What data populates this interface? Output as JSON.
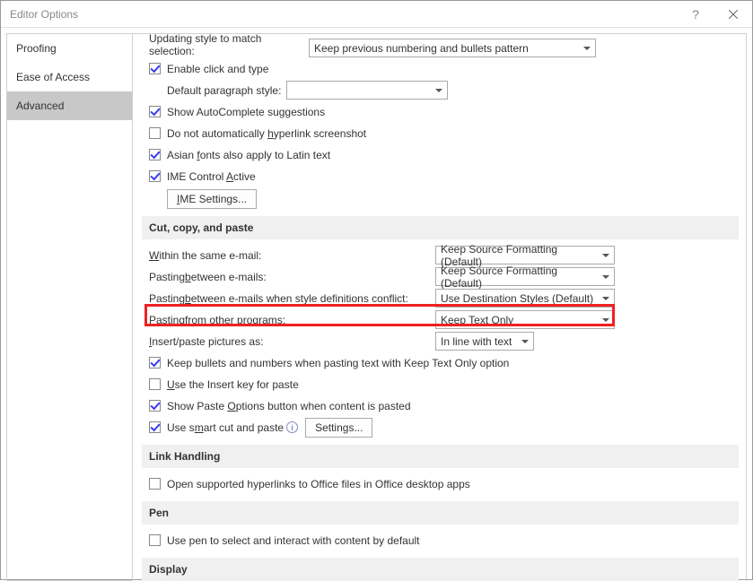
{
  "title": "Editor Options",
  "sidebar": {
    "items": [
      "Proofing",
      "Ease of Access",
      "Advanced"
    ],
    "selected": "Advanced"
  },
  "topPartial": {
    "updating_label": "Updating style to match selection:",
    "updating_value": "Keep previous numbering and bullets pattern",
    "enable_click": "Enable click and type",
    "default_para_label": "Default paragraph style:",
    "default_para_value": "",
    "show_autocomplete": "Show AutoComplete suggestions",
    "no_hyperlink": "Do not automatically hyperlink screenshot",
    "asian_fonts": "Asian fonts also apply to Latin text",
    "ime_active": "IME Control Active",
    "ime_settings": "IME Settings..."
  },
  "sections": {
    "cut": {
      "head": "Cut, copy, and paste",
      "within_label": "Within the same e-mail:",
      "within_value": "Keep Source Formatting (Default)",
      "between_label": "Pasting between e-mails:",
      "between_value": "Keep Source Formatting (Default)",
      "conflict_label": "Pasting between e-mails when style definitions conflict:",
      "conflict_value": "Use Destination Styles (Default)",
      "other_label": "Pasting from other programs:",
      "other_value": "Keep Text Only",
      "pictures_label": "Insert/paste pictures as:",
      "pictures_value": "In line with text",
      "keep_bullets": "Keep bullets and numbers when pasting text with Keep Text Only option",
      "insert_key": "Use the Insert key for paste",
      "show_paste": "Show Paste Options button when content is pasted",
      "smart_cut": "Use smart cut and paste",
      "settings_btn": "Settings..."
    },
    "link": {
      "head": "Link Handling",
      "open_supported": "Open supported hyperlinks to Office files in Office desktop apps"
    },
    "pen": {
      "head": "Pen",
      "use_pen": "Use pen to select and interact with content by default"
    },
    "display": {
      "head": "Display"
    }
  }
}
